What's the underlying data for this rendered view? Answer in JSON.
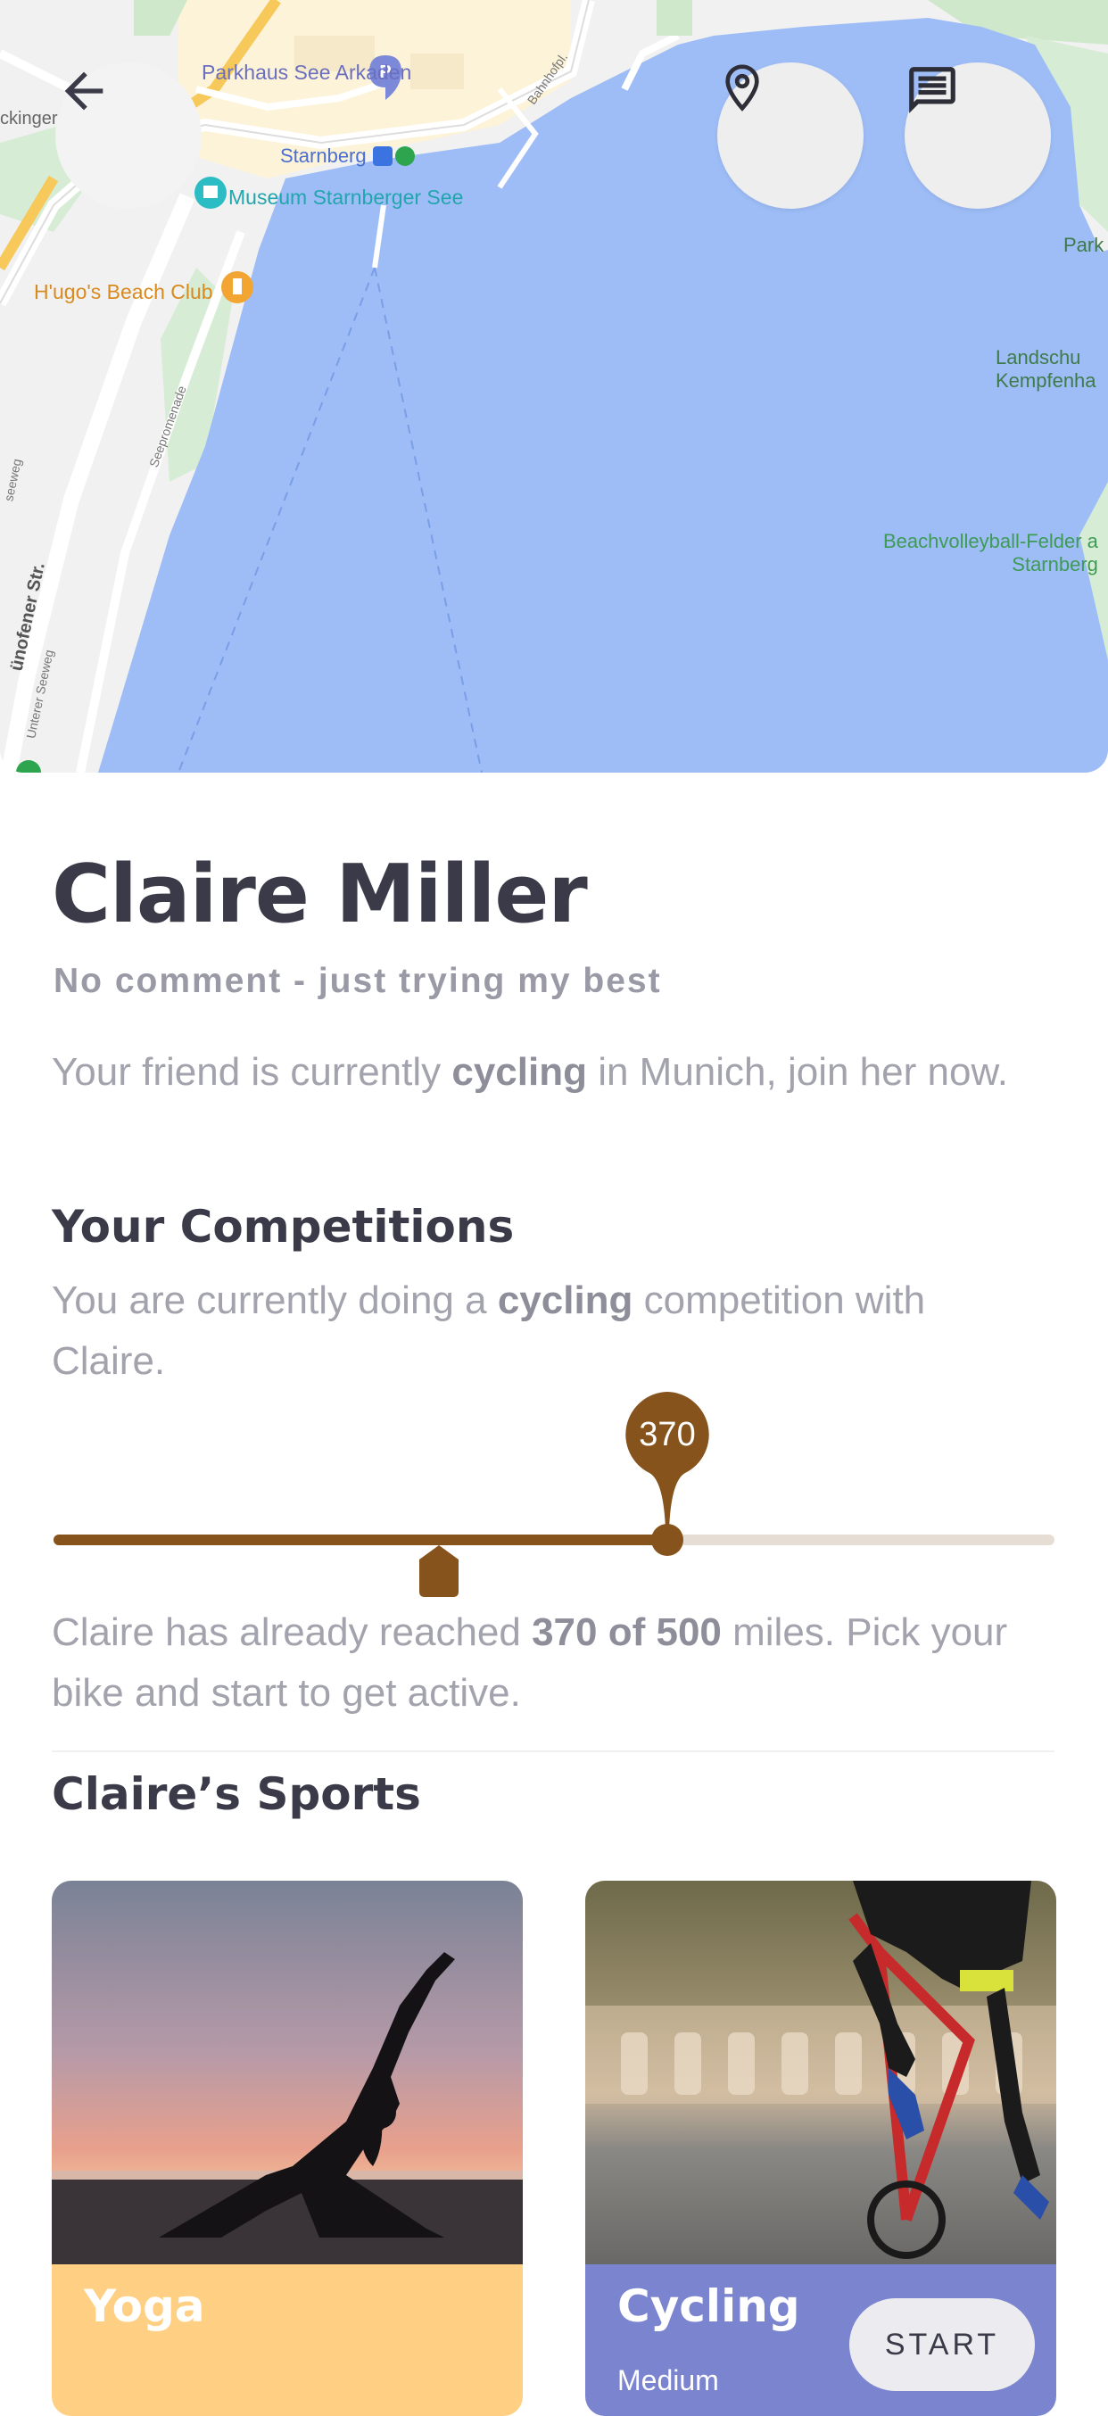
{
  "map": {
    "labels": {
      "parkhaus": "Parkhaus See Arkaden",
      "starnberg_station": "Starnberg",
      "museum": "Museum Starnberger See",
      "beach_club": "H'ugo's Beach Club",
      "kinger": "ckinger",
      "park": "Park",
      "landscape": "Landschu\nKempfenha",
      "beachvolleyball": "Beachvolleyball-Felder a\nStarnberg",
      "street1": "Bahnhofpl.",
      "street2": "Seepromenade",
      "street3": "ünofener Str.",
      "street4": "Unterer Seeweg",
      "street5": "seeweg"
    },
    "icons": [
      "back-arrow-icon",
      "location-pin-icon",
      "message-icon"
    ]
  },
  "profile": {
    "name": "Claire Miller",
    "status": "No comment - just trying my best",
    "intro": {
      "pre": "Your friend is currently ",
      "activity": "cycling",
      "post": " in Munich, join her now."
    }
  },
  "competitions": {
    "title": "Your Competitions",
    "desc": {
      "pre": "You are currently doing a ",
      "activity": "cycling",
      "post": " competition with Claire."
    },
    "slider": {
      "value": 370,
      "max": 500,
      "value_label": "370"
    },
    "progress": {
      "pre": "Claire has already reached ",
      "bold": "370 of 500",
      "post": " miles. Pick your bike and start to get active."
    }
  },
  "sports": {
    "title": "Claire’s Sports",
    "cards": [
      {
        "title": "Yoga",
        "color": "#ffd083"
      },
      {
        "title": "Cycling",
        "subtitle": "Medium",
        "button": "START",
        "color": "#7b84cf"
      }
    ]
  },
  "colors": {
    "accent": "#86531c",
    "track": "#e6ddd4",
    "heading": "#3a3a48",
    "text_muted": "#a3a3ad",
    "water": "#9ebdf7"
  }
}
